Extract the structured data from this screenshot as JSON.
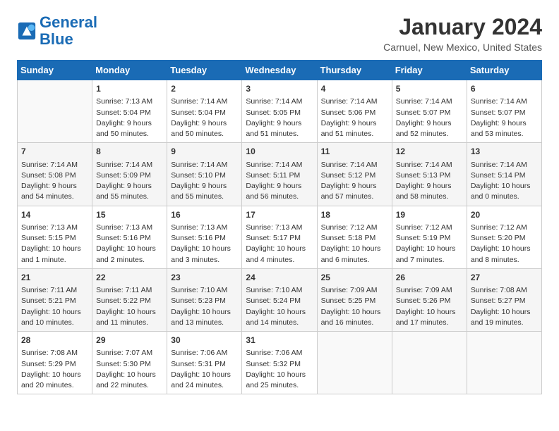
{
  "header": {
    "logo_line1": "General",
    "logo_line2": "Blue",
    "title": "January 2024",
    "subtitle": "Carnuel, New Mexico, United States"
  },
  "days_of_week": [
    "Sunday",
    "Monday",
    "Tuesday",
    "Wednesday",
    "Thursday",
    "Friday",
    "Saturday"
  ],
  "weeks": [
    [
      {
        "day": "",
        "info": ""
      },
      {
        "day": "1",
        "info": "Sunrise: 7:13 AM\nSunset: 5:04 PM\nDaylight: 9 hours\nand 50 minutes."
      },
      {
        "day": "2",
        "info": "Sunrise: 7:14 AM\nSunset: 5:04 PM\nDaylight: 9 hours\nand 50 minutes."
      },
      {
        "day": "3",
        "info": "Sunrise: 7:14 AM\nSunset: 5:05 PM\nDaylight: 9 hours\nand 51 minutes."
      },
      {
        "day": "4",
        "info": "Sunrise: 7:14 AM\nSunset: 5:06 PM\nDaylight: 9 hours\nand 51 minutes."
      },
      {
        "day": "5",
        "info": "Sunrise: 7:14 AM\nSunset: 5:07 PM\nDaylight: 9 hours\nand 52 minutes."
      },
      {
        "day": "6",
        "info": "Sunrise: 7:14 AM\nSunset: 5:07 PM\nDaylight: 9 hours\nand 53 minutes."
      }
    ],
    [
      {
        "day": "7",
        "info": "Sunrise: 7:14 AM\nSunset: 5:08 PM\nDaylight: 9 hours\nand 54 minutes."
      },
      {
        "day": "8",
        "info": "Sunrise: 7:14 AM\nSunset: 5:09 PM\nDaylight: 9 hours\nand 55 minutes."
      },
      {
        "day": "9",
        "info": "Sunrise: 7:14 AM\nSunset: 5:10 PM\nDaylight: 9 hours\nand 55 minutes."
      },
      {
        "day": "10",
        "info": "Sunrise: 7:14 AM\nSunset: 5:11 PM\nDaylight: 9 hours\nand 56 minutes."
      },
      {
        "day": "11",
        "info": "Sunrise: 7:14 AM\nSunset: 5:12 PM\nDaylight: 9 hours\nand 57 minutes."
      },
      {
        "day": "12",
        "info": "Sunrise: 7:14 AM\nSunset: 5:13 PM\nDaylight: 9 hours\nand 58 minutes."
      },
      {
        "day": "13",
        "info": "Sunrise: 7:14 AM\nSunset: 5:14 PM\nDaylight: 10 hours\nand 0 minutes."
      }
    ],
    [
      {
        "day": "14",
        "info": "Sunrise: 7:13 AM\nSunset: 5:15 PM\nDaylight: 10 hours\nand 1 minute."
      },
      {
        "day": "15",
        "info": "Sunrise: 7:13 AM\nSunset: 5:16 PM\nDaylight: 10 hours\nand 2 minutes."
      },
      {
        "day": "16",
        "info": "Sunrise: 7:13 AM\nSunset: 5:16 PM\nDaylight: 10 hours\nand 3 minutes."
      },
      {
        "day": "17",
        "info": "Sunrise: 7:13 AM\nSunset: 5:17 PM\nDaylight: 10 hours\nand 4 minutes."
      },
      {
        "day": "18",
        "info": "Sunrise: 7:12 AM\nSunset: 5:18 PM\nDaylight: 10 hours\nand 6 minutes."
      },
      {
        "day": "19",
        "info": "Sunrise: 7:12 AM\nSunset: 5:19 PM\nDaylight: 10 hours\nand 7 minutes."
      },
      {
        "day": "20",
        "info": "Sunrise: 7:12 AM\nSunset: 5:20 PM\nDaylight: 10 hours\nand 8 minutes."
      }
    ],
    [
      {
        "day": "21",
        "info": "Sunrise: 7:11 AM\nSunset: 5:21 PM\nDaylight: 10 hours\nand 10 minutes."
      },
      {
        "day": "22",
        "info": "Sunrise: 7:11 AM\nSunset: 5:22 PM\nDaylight: 10 hours\nand 11 minutes."
      },
      {
        "day": "23",
        "info": "Sunrise: 7:10 AM\nSunset: 5:23 PM\nDaylight: 10 hours\nand 13 minutes."
      },
      {
        "day": "24",
        "info": "Sunrise: 7:10 AM\nSunset: 5:24 PM\nDaylight: 10 hours\nand 14 minutes."
      },
      {
        "day": "25",
        "info": "Sunrise: 7:09 AM\nSunset: 5:25 PM\nDaylight: 10 hours\nand 16 minutes."
      },
      {
        "day": "26",
        "info": "Sunrise: 7:09 AM\nSunset: 5:26 PM\nDaylight: 10 hours\nand 17 minutes."
      },
      {
        "day": "27",
        "info": "Sunrise: 7:08 AM\nSunset: 5:27 PM\nDaylight: 10 hours\nand 19 minutes."
      }
    ],
    [
      {
        "day": "28",
        "info": "Sunrise: 7:08 AM\nSunset: 5:29 PM\nDaylight: 10 hours\nand 20 minutes."
      },
      {
        "day": "29",
        "info": "Sunrise: 7:07 AM\nSunset: 5:30 PM\nDaylight: 10 hours\nand 22 minutes."
      },
      {
        "day": "30",
        "info": "Sunrise: 7:06 AM\nSunset: 5:31 PM\nDaylight: 10 hours\nand 24 minutes."
      },
      {
        "day": "31",
        "info": "Sunrise: 7:06 AM\nSunset: 5:32 PM\nDaylight: 10 hours\nand 25 minutes."
      },
      {
        "day": "",
        "info": ""
      },
      {
        "day": "",
        "info": ""
      },
      {
        "day": "",
        "info": ""
      }
    ]
  ]
}
